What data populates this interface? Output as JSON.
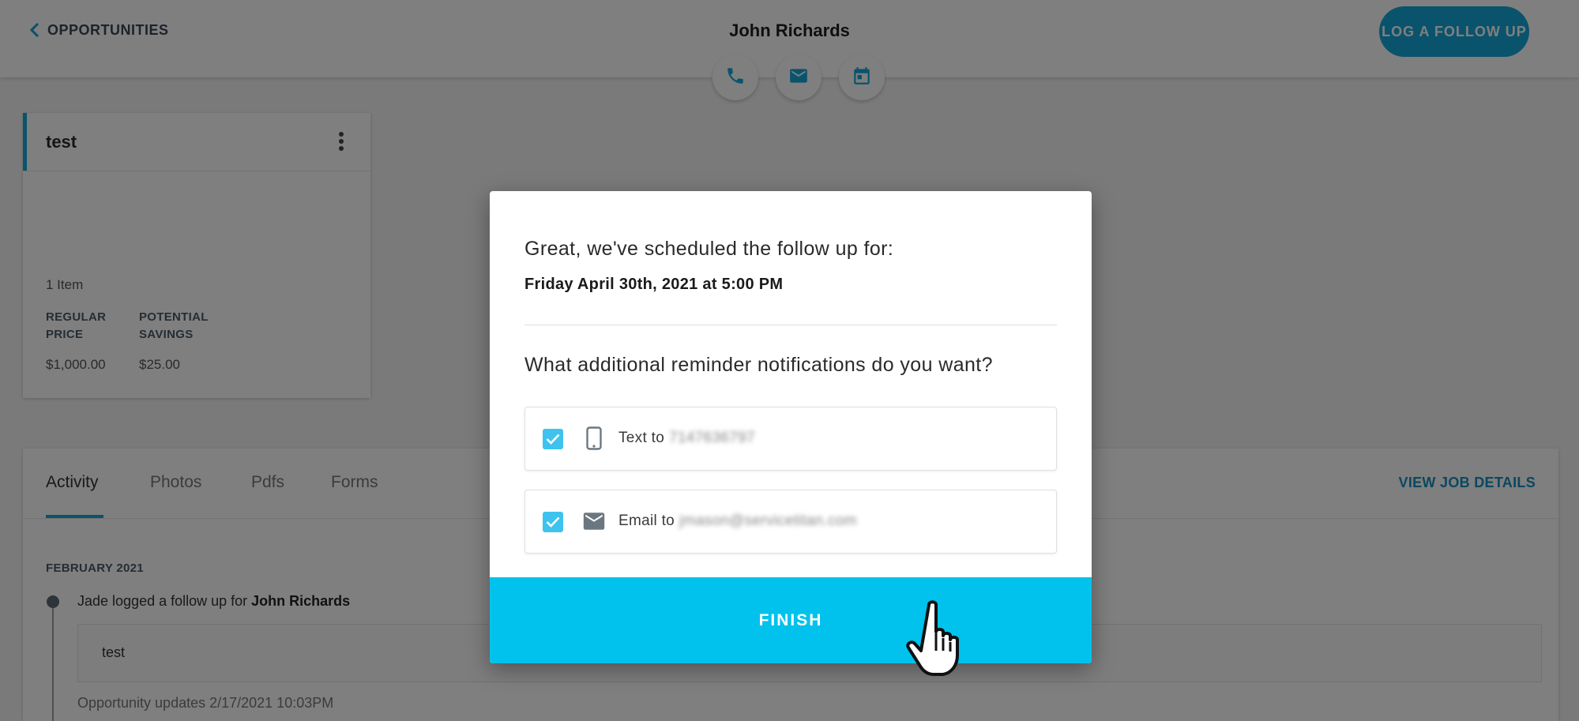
{
  "header": {
    "back_label": "OPPORTUNITIES",
    "contact_name": "John Richards",
    "log_button": "LOG A FOLLOW UP",
    "actions": [
      {
        "name": "phone-icon"
      },
      {
        "name": "email-icon"
      },
      {
        "name": "calendar-icon"
      }
    ]
  },
  "card": {
    "title": "test",
    "item_count": "1 Item",
    "regular_label_1": "REGULAR",
    "regular_label_2": "PRICE",
    "savings_label_1": "POTENTIAL",
    "savings_label_2": "SAVINGS",
    "regular_value": "$1,000.00",
    "savings_value": "$25.00"
  },
  "activity": {
    "tabs": [
      "Activity",
      "Photos",
      "Pdfs",
      "Forms"
    ],
    "active_tab": "Activity",
    "view_job": "VIEW JOB DETAILS",
    "month": "FEBRUARY 2021",
    "entry_prefix": "Jade logged a follow up for ",
    "entry_name": "John Richards",
    "note": "test",
    "updated": "Opportunity updates 2/17/2021 10:03PM"
  },
  "modal": {
    "heading": "Great, we've scheduled the follow up for:",
    "date": "Friday April 30th, 2021 at 5:00 PM",
    "question": "What additional reminder notifications do you want?",
    "options": [
      {
        "label": "Text to",
        "value": "7147636797",
        "checked": true,
        "icon": "phone-icon"
      },
      {
        "label": "Email to",
        "value": "jmason@servicetitan.com",
        "checked": true,
        "icon": "email-icon"
      }
    ],
    "finish": "FINISH"
  },
  "colors": {
    "accent": "#14a6d8",
    "finish_bg": "#00c2ec",
    "checkbox": "#3ec3ee"
  }
}
